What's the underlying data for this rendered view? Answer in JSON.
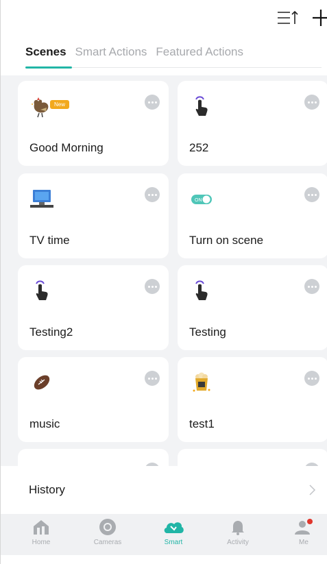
{
  "tabs": [
    {
      "label": "Scenes",
      "active": true
    },
    {
      "label": "Smart Actions",
      "active": false
    },
    {
      "label": "Featured Actions",
      "active": false
    }
  ],
  "scenes": [
    {
      "name": "Good Morning",
      "icon": "rooster-icon",
      "badge": "New"
    },
    {
      "name": "252",
      "icon": "tap-icon"
    },
    {
      "name": "TV time",
      "icon": "tv-icon"
    },
    {
      "name": "Turn on scene",
      "icon": "switch-on-icon",
      "icon_text": "ON"
    },
    {
      "name": "Testing2",
      "icon": "tap-icon"
    },
    {
      "name": "Testing",
      "icon": "tap-icon"
    },
    {
      "name": "music",
      "icon": "football-icon"
    },
    {
      "name": "test1",
      "icon": "popcorn-icon"
    }
  ],
  "history": {
    "label": "History"
  },
  "bottom_nav": [
    {
      "label": "Home",
      "icon": "home-icon"
    },
    {
      "label": "Cameras",
      "icon": "camera-icon"
    },
    {
      "label": "Smart",
      "icon": "smart-icon",
      "active": true
    },
    {
      "label": "Activity",
      "icon": "bell-icon"
    },
    {
      "label": "Me",
      "icon": "person-icon",
      "notification_dot": true
    }
  ],
  "colors": {
    "accent": "#21b5a6",
    "badge": "#f2a91d",
    "notification": "#e0362c"
  }
}
